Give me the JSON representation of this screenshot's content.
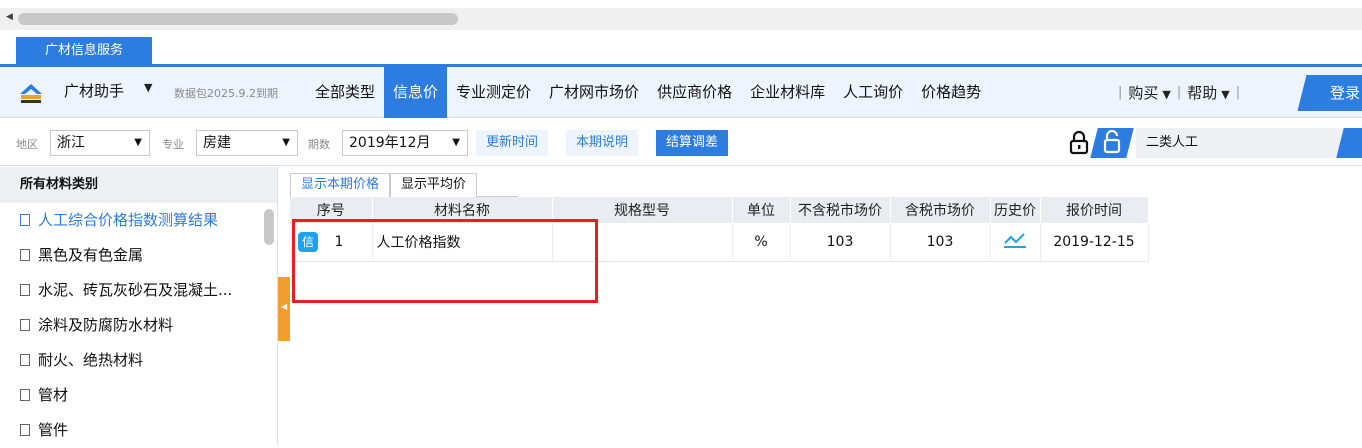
{
  "app_tab": "广材信息服务",
  "header": {
    "brand": "广材助手",
    "package_notice": "数据包2025.9.2到期",
    "nav": [
      "全部类型",
      "信息价",
      "专业测定价",
      "广材网市场价",
      "供应商价格",
      "企业材料库",
      "人工询价",
      "价格趋势"
    ],
    "active_nav": "信息价",
    "buy": "购买",
    "help": "帮助",
    "login": "登录"
  },
  "filters": {
    "region_label": "地区",
    "region_value": "浙江",
    "major_label": "专业",
    "major_value": "房建",
    "period_label": "期数",
    "period_value": "2019年12月",
    "update_time": "更新时间",
    "period_desc": "本期说明",
    "settle_diff": "结算调差",
    "labor_type": "二类人工"
  },
  "sidebar": {
    "title": "所有材料类别",
    "items": [
      "人工综合价格指数测算结果",
      "黑色及有色金属",
      "水泥、砖瓦灰砂石及混凝土...",
      "涂料及防腐防水材料",
      "耐火、绝热材料",
      "管材",
      "管件"
    ]
  },
  "subtabs": [
    "显示本期价格",
    "显示平均价"
  ],
  "table": {
    "columns": [
      "序号",
      "材料名称",
      "规格型号",
      "单位",
      "不含税市场价",
      "含税市场价",
      "历史价",
      "报价时间"
    ],
    "rows": [
      {
        "badge": "信",
        "index": "1",
        "name": "人工价格指数",
        "spec": "",
        "unit": "%",
        "price_ex_tax": "103",
        "price_in_tax": "103",
        "report_date": "2019-12-15"
      }
    ]
  },
  "colors": {
    "accent": "#2d7ce0",
    "highlight": "#e81f1f",
    "badge": "#1aa3f0",
    "collapse": "#f39c2f"
  }
}
